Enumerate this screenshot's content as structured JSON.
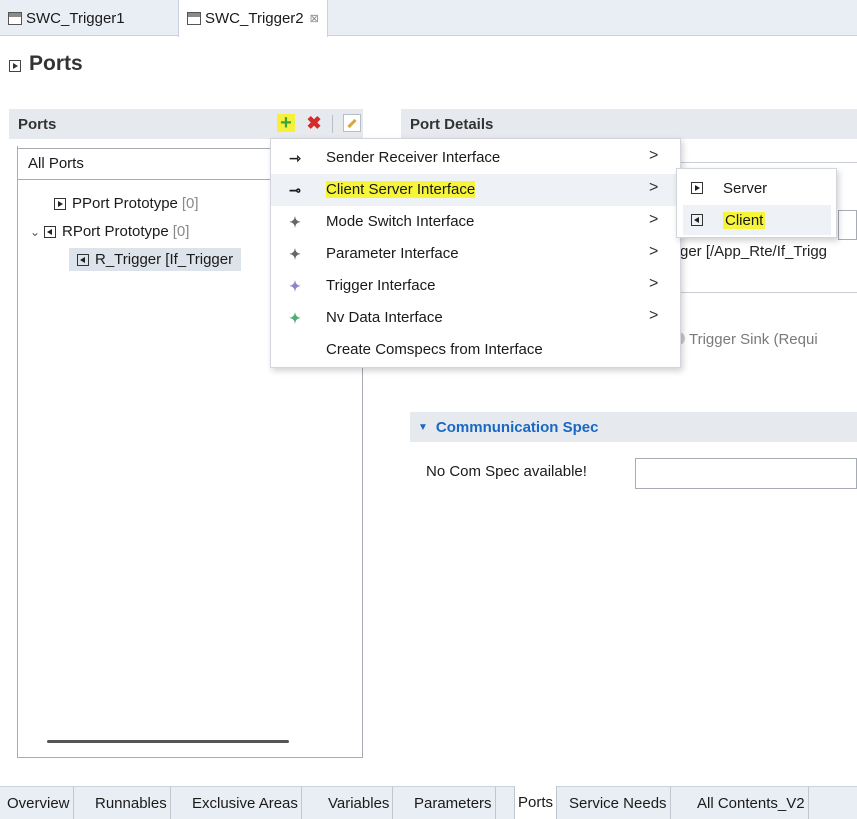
{
  "editor_tabs": [
    {
      "label": "SWC_Trigger1",
      "active": false
    },
    {
      "label": "SWC_Trigger2",
      "active": true,
      "close_icon": "⊠"
    }
  ],
  "page_title": "Ports",
  "ports_section": {
    "title": "Ports",
    "filter_value": "All Ports",
    "tree": [
      {
        "label": "PPort Prototype",
        "count": "[0]",
        "icon": "pport-icon"
      },
      {
        "label": "RPort Prototype",
        "count": "[0]",
        "icon": "rport-icon",
        "expanded": true
      },
      {
        "label": "R_Trigger [If_Trigger",
        "icon": "rport-icon",
        "selected": true
      }
    ]
  },
  "details_section": {
    "title": "Port Details",
    "interface_text": "ger [/App_Rte/If_Trigg",
    "trigger_sink_text": "Trigger Sink (Requi"
  },
  "comm_spec": {
    "title": "Commnunication Spec",
    "no_spec_label": "No Com Spec available!"
  },
  "context_menu": {
    "items": [
      {
        "label": "Sender Receiver Interface",
        "icon": "sender-receiver-icon",
        "submenu": true
      },
      {
        "label": "Client Server Interface",
        "icon": "client-server-icon",
        "submenu": true,
        "highlighted": true
      },
      {
        "label": "Mode Switch Interface",
        "icon": "mode-switch-icon",
        "submenu": true
      },
      {
        "label": "Parameter Interface",
        "icon": "parameter-icon",
        "submenu": true
      },
      {
        "label": "Trigger Interface",
        "icon": "trigger-icon",
        "submenu": true
      },
      {
        "label": "Nv Data Interface",
        "icon": "nv-data-icon",
        "submenu": true
      },
      {
        "label": "Create Comspecs from Interface",
        "submenu": false
      }
    ],
    "arrow": ">"
  },
  "submenu": {
    "items": [
      {
        "label": "Server",
        "icon": "server-port-icon"
      },
      {
        "label": "Client",
        "icon": "client-port-icon",
        "highlighted": true
      }
    ]
  },
  "bottom_tabs": [
    {
      "label": "Overview"
    },
    {
      "label": "Runnables"
    },
    {
      "label": "Exclusive Areas"
    },
    {
      "label": "Variables"
    },
    {
      "label": "Parameters"
    },
    {
      "label": "Ports",
      "active": true
    },
    {
      "label": "Service Needs"
    },
    {
      "label": "All Contents_V2"
    }
  ],
  "colors": {
    "highlight": "#f6f53a",
    "section_header_bg": "#e6e9ee",
    "comm_spec_title": "#1a68c5",
    "delete_red": "#d52b2b",
    "add_green": "#3aa53a"
  }
}
